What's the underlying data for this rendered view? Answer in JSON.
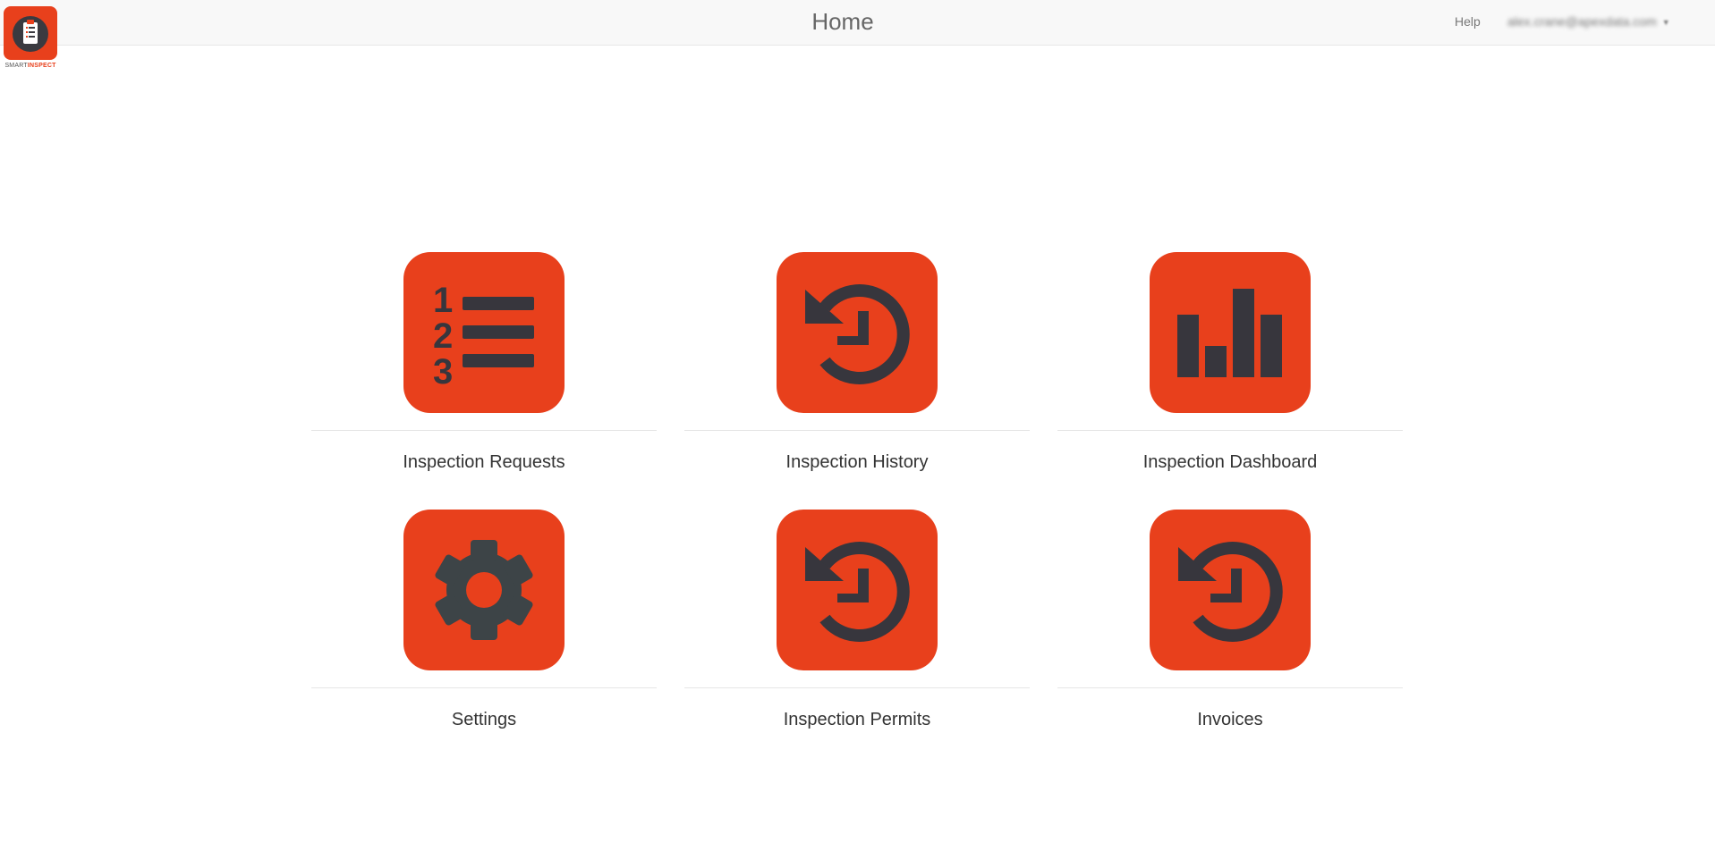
{
  "header": {
    "title": "Home",
    "help_label": "Help",
    "user_email": "alex.crane@apexdata.com",
    "caret": "▼",
    "logo_text_left": "SMART",
    "logo_text_right": "INSPECT"
  },
  "colors": {
    "accent": "#e8401c",
    "icon_dark": "#37363d",
    "header_bg": "#f8f8f8"
  },
  "tiles": [
    {
      "label": "Inspection Requests",
      "icon": "numbered-list-icon"
    },
    {
      "label": "Inspection History",
      "icon": "history-icon"
    },
    {
      "label": "Inspection Dashboard",
      "icon": "bar-chart-icon"
    },
    {
      "label": "Settings",
      "icon": "gear-icon"
    },
    {
      "label": "Inspection Permits",
      "icon": "history-icon"
    },
    {
      "label": "Invoices",
      "icon": "history-icon"
    }
  ]
}
